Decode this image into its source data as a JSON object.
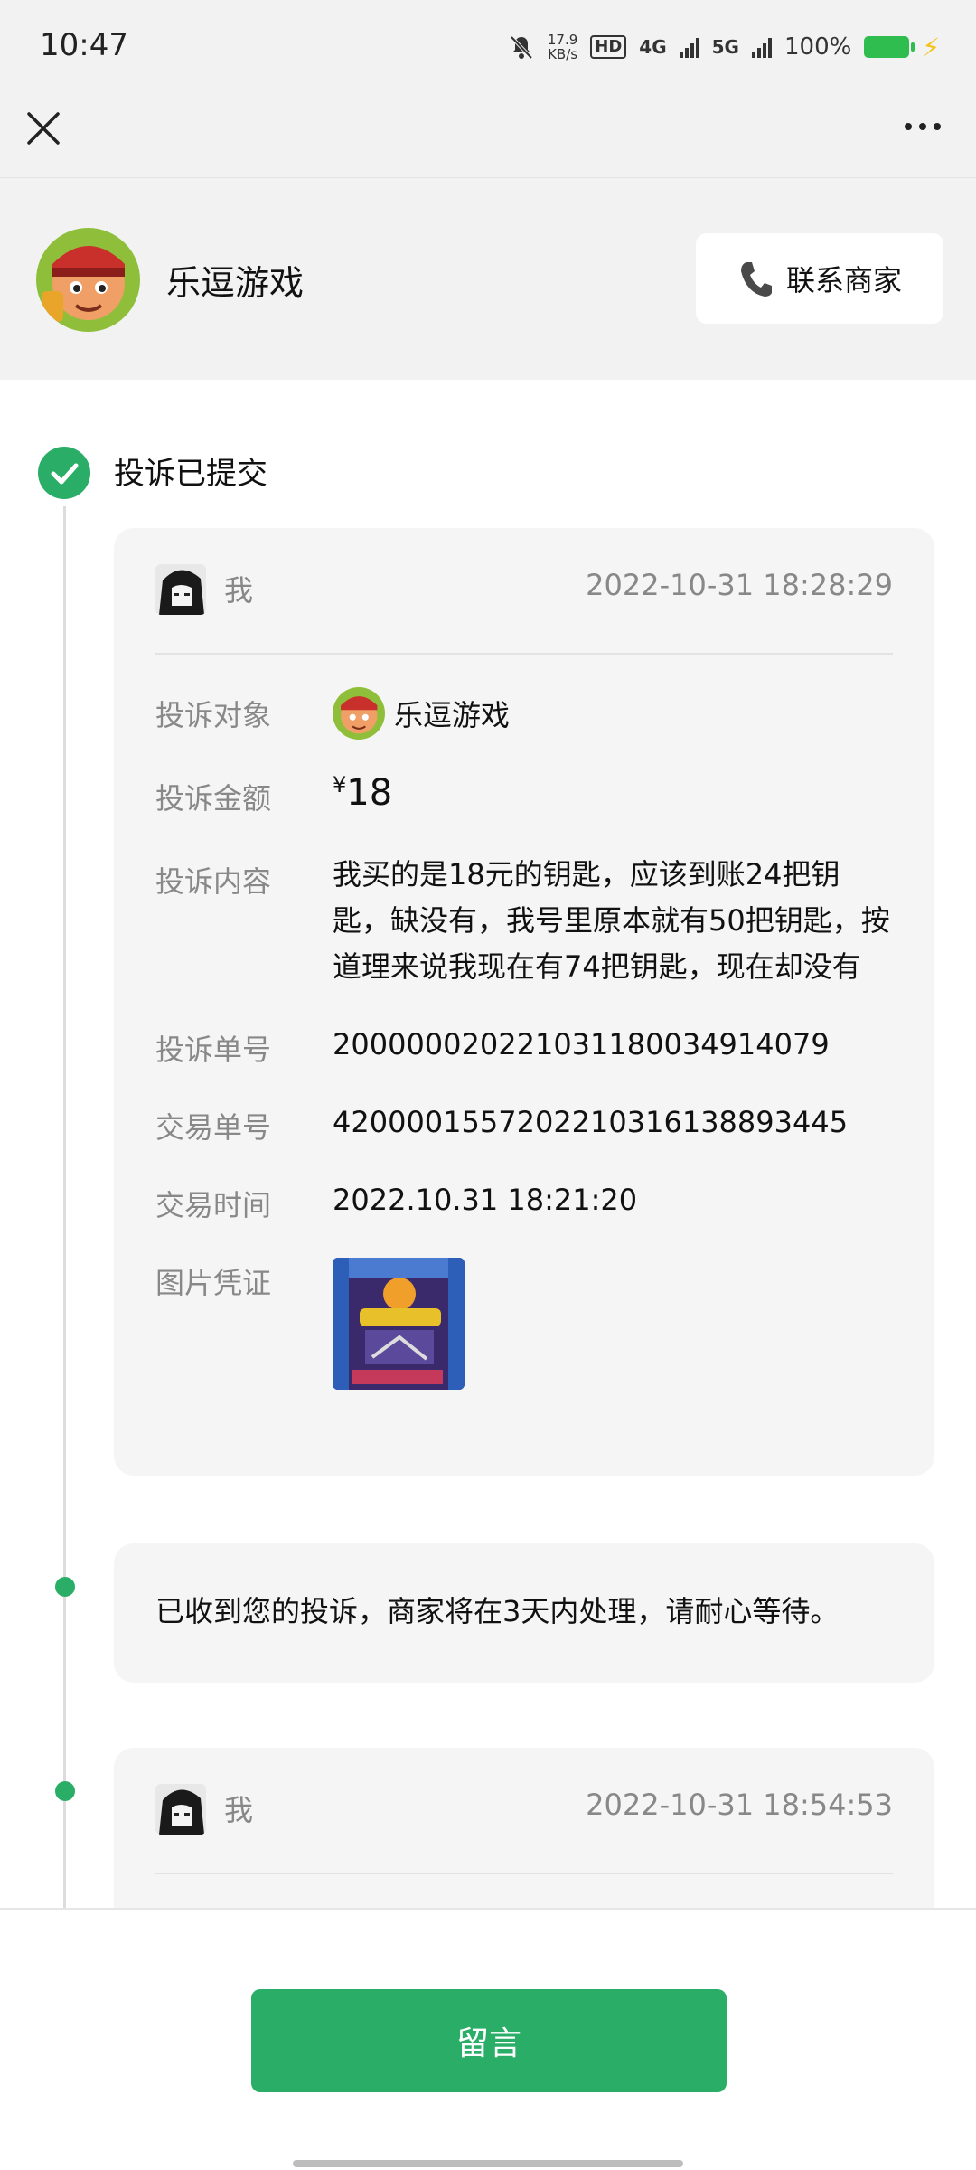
{
  "status_bar": {
    "time": "10:47",
    "net_speed_value": "17.9",
    "net_speed_unit": "KB/s",
    "hd_label": "HD",
    "network_4g": "4G",
    "network_5g": "5G",
    "battery_percent": "100%",
    "battery_color": "#2ebd4e"
  },
  "nav": {
    "close_icon": "close-icon",
    "more_icon": "more-icon"
  },
  "merchant": {
    "name": "乐逗游戏",
    "contact_label": "联系商家"
  },
  "timeline": {
    "step_title": "投诉已提交",
    "accent_color": "#2aae67"
  },
  "complaint_card": {
    "user_name": "我",
    "time": "2022-10-31 18:28:29",
    "fields": {
      "target_label": "投诉对象",
      "target_value": "乐逗游戏",
      "amount_label": "投诉金额",
      "amount_currency": "¥",
      "amount_value": "18",
      "content_label": "投诉内容",
      "content_value": "我买的是18元的钥匙，应该到账24把钥匙，缺没有，我号里原本就有50把钥匙，按道理来说我现在有74把钥匙，现在却没有",
      "complaint_no_label": "投诉单号",
      "complaint_no_value": "200000020221031180034914079",
      "trade_no_label": "交易单号",
      "trade_no_value": "4200001557202210316138893445",
      "trade_time_label": "交易时间",
      "trade_time_value": "2022.10.31 18:21:20",
      "evidence_label": "图片凭证"
    }
  },
  "notice_card": {
    "text": "已收到您的投诉，商家将在3天内处理，请耐心等待。"
  },
  "second_card": {
    "user_name": "我",
    "time": "2022-10-31 18:54:53"
  },
  "bottom": {
    "leave_message_label": "留言"
  }
}
